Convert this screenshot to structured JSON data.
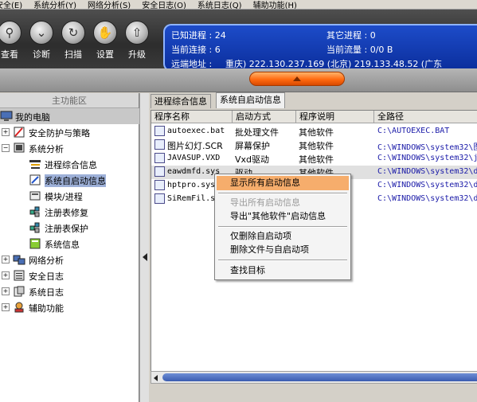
{
  "menubar": [
    "安全(E)",
    "系统分析(Y)",
    "网络分析(S)",
    "安全日志(O)",
    "系统日志(Q)",
    "辅助功能(H)"
  ],
  "toolbar": {
    "buttons": [
      {
        "label": "查看",
        "icon": "magnifier-icon"
      },
      {
        "label": "诊断",
        "icon": "stethoscope-icon"
      },
      {
        "label": "扫描",
        "icon": "scan-icon"
      },
      {
        "label": "设置",
        "icon": "settings-icon"
      },
      {
        "label": "升级",
        "icon": "upgrade-icon"
      }
    ]
  },
  "status": {
    "known_process_label": "已知进程 : 24",
    "other_process_label": "其它进程 : 0",
    "current_conn_label": "当前连接 : 6",
    "current_flow_label": "当前流量 : 0/0 B",
    "remote_addr_label": "远端地址 :",
    "remote_addr_value": "重庆)    222.130.237.169 (北京)    219.133.48.52 (广东"
  },
  "sidebar": {
    "header": "主功能区",
    "items": [
      {
        "label": "我的电脑",
        "icon": "computer-icon"
      },
      {
        "label": "安全防护与策略",
        "icon": "shield-policy-icon"
      },
      {
        "label": "系统分析",
        "icon": "monitor-icon"
      },
      {
        "label": "进程综合信息",
        "icon": "process-info-icon"
      },
      {
        "label": "系统自启动信息",
        "icon": "startup-icon"
      },
      {
        "label": "模块/进程",
        "icon": "module-icon"
      },
      {
        "label": "注册表修复",
        "icon": "registry-repair-icon"
      },
      {
        "label": "注册表保护",
        "icon": "registry-protect-icon"
      },
      {
        "label": "系统信息",
        "icon": "system-info-icon"
      },
      {
        "label": "网络分析",
        "icon": "network-icon"
      },
      {
        "label": "安全日志",
        "icon": "security-log-icon"
      },
      {
        "label": "系统日志",
        "icon": "system-log-icon"
      },
      {
        "label": "辅助功能",
        "icon": "tools-icon"
      }
    ]
  },
  "tabs": [
    "进程综合信息",
    "系统自启动信息"
  ],
  "table": {
    "columns": [
      "程序名称",
      "启动方式",
      "程序说明",
      "全路径"
    ],
    "rows": [
      {
        "name": "autoexec.bat",
        "mode": "批处理文件",
        "desc": "其他软件",
        "path": "C:\\AUTOEXEC.BAT"
      },
      {
        "name": "图片幻灯.SCR",
        "mode": "屏幕保护",
        "desc": "其他软件",
        "path": "C:\\WINDOWS\\system32\\图"
      },
      {
        "name": "JAVASUP.VXD",
        "mode": "Vxd驱动",
        "desc": "其他软件",
        "path": "C:\\WINDOWS\\system32\\j"
      },
      {
        "name": "eawdmfd.sys",
        "mode": "驱动",
        "desc": "其他软件",
        "path": "C:\\WINDOWS\\system32\\d"
      },
      {
        "name": "hptpro.sys",
        "mode": "",
        "desc": "",
        "path": "C:\\WINDOWS\\system32\\d"
      },
      {
        "name": "SiRemFil.s",
        "mode": "",
        "desc": "",
        "path": "C:\\WINDOWS\\system32\\d"
      }
    ]
  },
  "context_menu": {
    "items": [
      {
        "label": "显示所有启动信息",
        "state": "hover"
      },
      {
        "label": "导出所有启动信息",
        "state": "disabled"
      },
      {
        "label": "导出\"其他软件\"启动信息",
        "state": "normal"
      },
      {
        "label": "仅删除自启动项",
        "state": "normal"
      },
      {
        "label": "删除文件与自启动项",
        "state": "normal"
      },
      {
        "label": "查找目标",
        "state": "normal"
      }
    ]
  },
  "colors": {
    "accent_orange": "#ff6a10",
    "status_blue": "#0b2e9c",
    "selection": "#9db0d8",
    "menu_hover": "#f6ad6c"
  }
}
